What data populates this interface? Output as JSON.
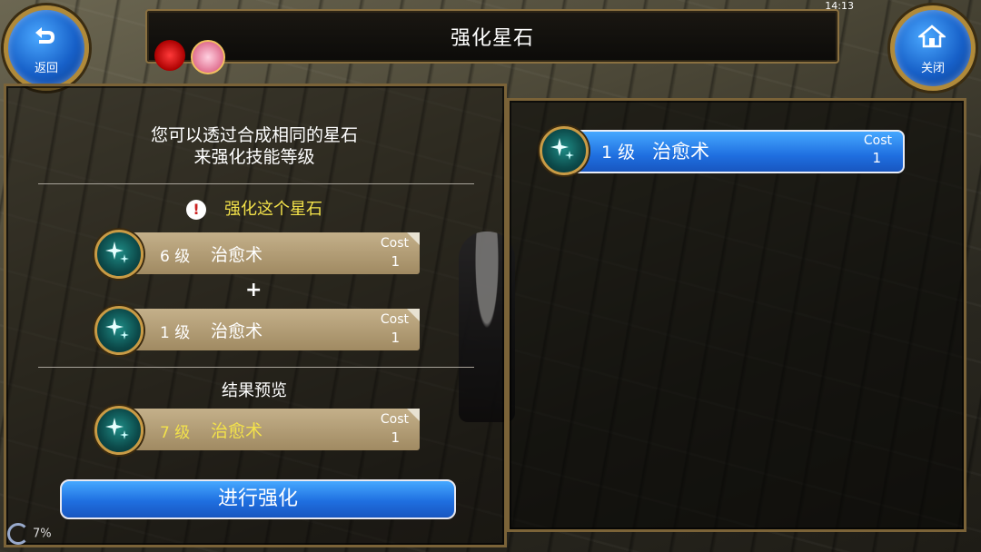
{
  "header": {
    "title": "强化星石",
    "back_label": "返回",
    "close_label": "关闭",
    "status_time": "14:13"
  },
  "left": {
    "intro_line1": "您可以透过合成相同的星石",
    "intro_line2": "来强化技能等级",
    "target_heading": "强化这个星石",
    "target": {
      "level": "6 级",
      "name": "治愈术",
      "cost_label": "Cost",
      "cost": "1"
    },
    "plus": "+",
    "material": {
      "level": "1 级",
      "name": "治愈术",
      "cost_label": "Cost",
      "cost": "1"
    },
    "preview_heading": "结果预览",
    "result": {
      "level": "7 级",
      "name": "治愈术",
      "cost_label": "Cost",
      "cost": "1"
    },
    "enhance_button": "进行强化"
  },
  "right": {
    "items": [
      {
        "level": "1 级",
        "name": "治愈术",
        "cost_label": "Cost",
        "cost": "1"
      }
    ]
  },
  "loading_percent": "7%",
  "colors": {
    "accent_blue": "#1f6fe0",
    "highlight_yellow": "#f3e24a",
    "frame_gold": "#7b6338"
  }
}
